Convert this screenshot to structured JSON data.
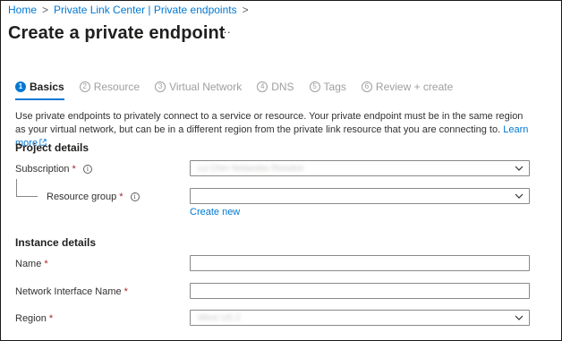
{
  "breadcrumb": {
    "items": [
      "Home",
      "Private Link Center | Private endpoints"
    ],
    "separator": ">"
  },
  "page": {
    "title": "Create a private endpoint",
    "more_label": "···"
  },
  "tabs": [
    {
      "number": "1",
      "label": "Basics",
      "active": true
    },
    {
      "number": "2",
      "label": "Resource",
      "active": false
    },
    {
      "number": "3",
      "label": "Virtual Network",
      "active": false
    },
    {
      "number": "4",
      "label": "DNS",
      "active": false
    },
    {
      "number": "5",
      "label": "Tags",
      "active": false
    },
    {
      "number": "6",
      "label": "Review + create",
      "active": false
    }
  ],
  "description": {
    "text": "Use private endpoints to privately connect to a service or resource. Your private endpoint must be in the same region as your virtual network, but can be in a different region from the private link resource that you are connecting to.",
    "learn_more": "Learn more"
  },
  "project_details": {
    "heading": "Project details",
    "subscription": {
      "label": "Subscription",
      "required_mark": "*",
      "value": "Lo Chm Networks Resolve"
    },
    "resource_group": {
      "label": "Resource group",
      "required_mark": "*",
      "value": ""
    },
    "create_new": "Create new"
  },
  "instance_details": {
    "heading": "Instance details",
    "name": {
      "label": "Name",
      "required_mark": "*",
      "value": ""
    },
    "nic_name": {
      "label": "Network Interface Name",
      "required_mark": "*",
      "value": ""
    },
    "region": {
      "label": "Region",
      "required_mark": "*",
      "value": "West US 2"
    }
  },
  "icons": {
    "info": "info-icon",
    "chevron": "chevron-down-icon",
    "external": "external-link-icon"
  },
  "colors": {
    "accent": "#0078d4",
    "required": "#a4262c",
    "border": "#8a8886"
  }
}
